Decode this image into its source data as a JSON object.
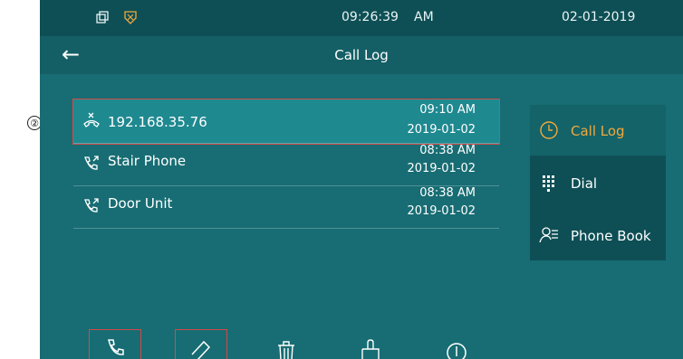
{
  "annotation": {
    "number": "②"
  },
  "statusbar": {
    "time": "09:26:39",
    "ampm": "AM",
    "date": "02-01-2019",
    "icons": [
      "window-icon",
      "shield-icon"
    ]
  },
  "header": {
    "title": "Call Log",
    "back_icon": "back-arrow-icon"
  },
  "call_log": [
    {
      "name": "192.168.35.76",
      "time": "09:10 AM",
      "date": "2019-01-02",
      "icon": "missed-call-icon",
      "selected": true
    },
    {
      "name": "Stair Phone",
      "time": "08:38 AM",
      "date": "2019-01-02",
      "icon": "outgoing-call-icon",
      "selected": false
    },
    {
      "name": "Door Unit",
      "time": "08:38 AM",
      "date": "2019-01-02",
      "icon": "outgoing-call-icon",
      "selected": false
    }
  ],
  "side_menu": [
    {
      "label": "Call Log",
      "icon": "clock-icon",
      "active": true
    },
    {
      "label": "Dial",
      "icon": "keypad-icon",
      "active": false
    },
    {
      "label": "Phone Book",
      "icon": "contacts-icon",
      "active": false
    }
  ],
  "colors": {
    "accent": "#f2a93b",
    "highlight": "#d24a4a",
    "background": "#176d73"
  },
  "bottom_actions": [
    "call-icon",
    "unlock-icon",
    "delete-icon",
    "clear-icon",
    "info-icon"
  ]
}
